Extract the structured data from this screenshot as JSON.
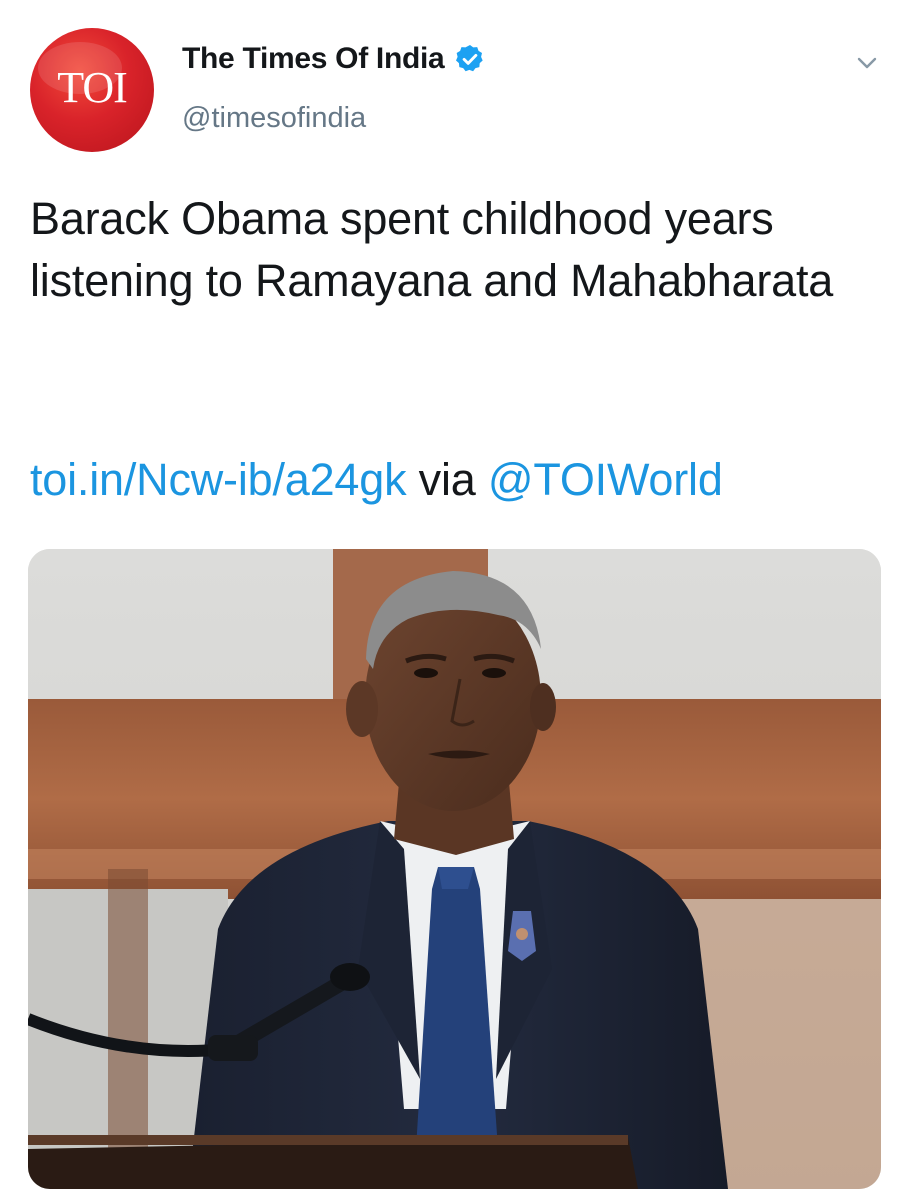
{
  "account": {
    "avatar_text": "TOI",
    "display_name": "The Times Of India",
    "handle": "@timesofindia",
    "verified": true
  },
  "tweet": {
    "text": "Barack Obama spent childhood years listening to Ramayana and Mahabharata",
    "link_text": "toi.in/Ncw-ib/a24gk",
    "via_text": " via ",
    "mention_text": "@TOIWorld"
  },
  "icons": {
    "menu": "chevron-down-icon",
    "verified": "verified-badge-icon"
  },
  "colors": {
    "link": "#1b95e0",
    "avatar_red": "#d9232a",
    "handle_gray": "#657786"
  }
}
